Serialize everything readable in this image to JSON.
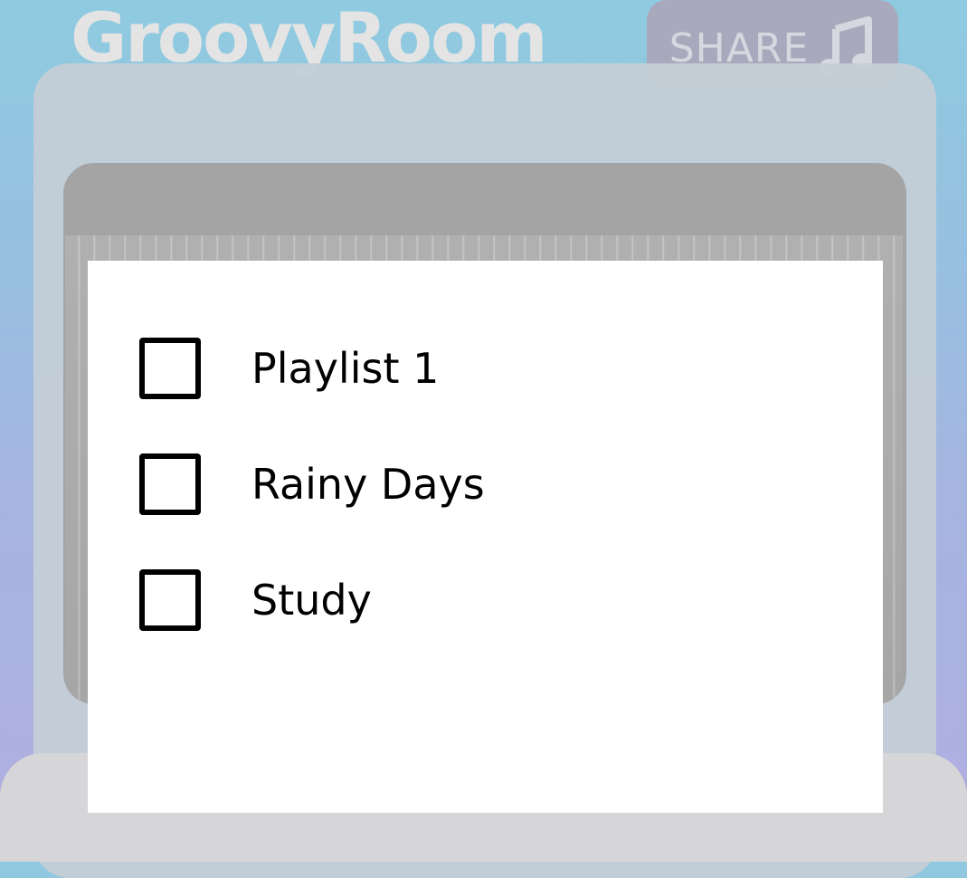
{
  "header": {
    "app_title": "GroovyRoom",
    "share_label": "SHARE",
    "share_icon": "music-note-icon"
  },
  "playlist_dialog": {
    "options": [
      {
        "label": "Playlist 1",
        "checked": false
      },
      {
        "label": "Rainy Days",
        "checked": false
      },
      {
        "label": "Study",
        "checked": false
      }
    ]
  },
  "colors": {
    "background_top": "#8ecbe0",
    "background_bottom": "#aeb0e0",
    "dialog": "#ffffff",
    "checkbox_border": "#000000"
  }
}
